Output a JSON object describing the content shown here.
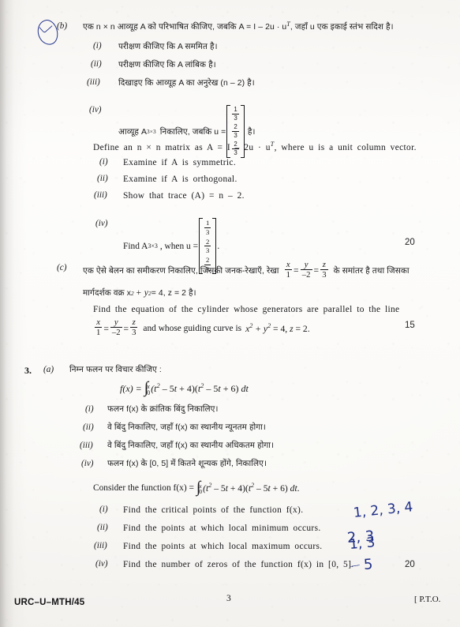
{
  "document": {
    "type": "examination-question-paper",
    "page_number": "3",
    "paper_code": "URC–U–MTH/45",
    "pto_note": "[ P.T.O."
  },
  "q2b": {
    "label": "(b)",
    "hindi_stem": "एक n × n आव्यूह A को परिभाषित कीजिए, जबकि A = I – 2u · u",
    "hindi_stem_tail": ", जहाँ u एक इकाई स्तंभ सदिश है।",
    "hindi_items": [
      {
        "marker": "(i)",
        "text_pre": "परीक्षण कीजिए कि A सममित है।"
      },
      {
        "marker": "(ii)",
        "text_pre": "परीक्षण कीजिए कि A लांबिक है।"
      },
      {
        "marker": "(iii)",
        "text_pre": "दिखाइए कि आव्यूह A का अनुरेख (n – 2) है।"
      },
      {
        "marker": "(iv)",
        "text_pre": "आव्यूह A",
        "text_sub": "3×3",
        "text_mid": "निकालिए, जबकि u =",
        "text_post": "है।"
      }
    ],
    "english_stem_pre": "Define an n × n matrix as A = I – 2u · u",
    "english_stem_post": ", where u is a unit column vector.",
    "english_items": [
      {
        "marker": "(i)",
        "text": "Examine if A is symmetric."
      },
      {
        "marker": "(ii)",
        "text": "Examine if A is orthogonal."
      },
      {
        "marker": "(iii)",
        "text": "Show that trace (A) = n – 2."
      },
      {
        "marker": "(iv)",
        "text_pre": "Find A",
        "text_sub": "3×3",
        "text_mid": ", when u =",
        "text_post": "."
      }
    ],
    "unit_vector": [
      "1/3",
      "2/3",
      "2/3"
    ],
    "marks": "20"
  },
  "q2c": {
    "label": "(c)",
    "hindi_line1_pre": "एक ऐसे बेलन का समीकरण निकालिए, जिसकी जनक-रेखाएँ, रेखा",
    "hindi_line1_post": "के समांतर है तथा जिसका",
    "hindi_line2_pre": "मार्गदर्शक वक्र x",
    "hindi_line2_post": " = 4, z = 2 है।",
    "english_line1": "Find the equation of the cylinder whose generators are parallel to the line",
    "english_line2_mid": "and whose guiding curve is",
    "line_ratios": {
      "x_over": "x",
      "x_den": "1",
      "y_over": "y",
      "y_den": "–2",
      "z_over": "z",
      "z_den": "3"
    },
    "guiding_curve": "x² + y² = 4, z = 2",
    "marks": "15"
  },
  "q3": {
    "number": "3.",
    "label_a": "(a)",
    "hindi_stem": "निम्न फलन पर विचार कीजिए :",
    "formula": {
      "lhs": "f(x) =",
      "integral_lower": "0",
      "integral_upper": "x",
      "integrand": "(t² – 5t + 4)(t² – 5t + 6) dt"
    },
    "hindi_items": [
      {
        "marker": "(i)",
        "text": "फलन f(x) के क्रांतिक बिंदु निकालिए।"
      },
      {
        "marker": "(ii)",
        "text": "वे बिंदु निकालिए, जहाँ f(x) का स्थानीय न्यूनतम होगा।"
      },
      {
        "marker": "(iii)",
        "text": "वे बिंदु निकालिए, जहाँ f(x) का स्थानीय अधिकतम होगा।"
      },
      {
        "marker": "(iv)",
        "text": "फलन f(x) के [0, 5] में कितने शून्यक होंगे, निकालिए।"
      }
    ],
    "english_stem": "Consider the function f(x) =",
    "english_stem_tail": "(t² – 5t + 4)(t² – 5t + 6) dt.",
    "english_items": [
      {
        "marker": "(i)",
        "text": "Find the critical points of the function f(x)."
      },
      {
        "marker": "(ii)",
        "text": "Find the points at which local minimum occurs."
      },
      {
        "marker": "(iii)",
        "text": "Find the points at which local maximum occurs."
      },
      {
        "marker": "(iv)",
        "text_pre": "Find the number of zeros of the function f(x) in [0, 5]."
      }
    ],
    "marks": "20"
  },
  "annotations": {
    "ink_color": "#23348c",
    "critical_points": "1, 2, 3, 4",
    "local_minimum": "2, 3",
    "local_maximum": "1, 3",
    "zeros_count": "5"
  }
}
